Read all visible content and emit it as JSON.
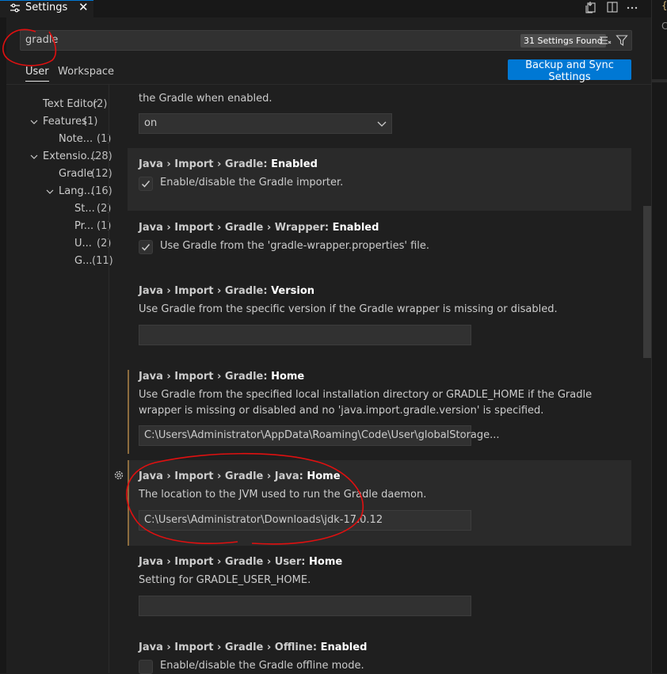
{
  "editor": {
    "tab_title": "Settings",
    "tab_close_glyph": "✕",
    "right_partial_brace": "{",
    "right_partial_letter": "C"
  },
  "search": {
    "value": "gradle",
    "results_badge": "31 Settings Found"
  },
  "scopes": {
    "user": "User",
    "workspace": "Workspace"
  },
  "sync_button": "Backup and Sync Settings",
  "toc": [
    {
      "label": "Text Editor",
      "count": "(2)"
    },
    {
      "label": "Features",
      "count": "(1)"
    },
    {
      "label": "Note...",
      "count": "(1)"
    },
    {
      "label": "Extensio...",
      "count": "(28)"
    },
    {
      "label": "Gradle",
      "count": "(12)"
    },
    {
      "label": "Lang...",
      "count": "(16)"
    },
    {
      "label": "St...",
      "count": "(2)"
    },
    {
      "label": "Pr...",
      "count": "(1)"
    },
    {
      "label": "U...",
      "count": "(2)"
    },
    {
      "label": "G...",
      "count": "(11)"
    }
  ],
  "settings": {
    "partial_top": {
      "desc_tail": "the Gradle when enabled.",
      "select_value": "on"
    },
    "gradle_enabled": {
      "category": "Java › Import › Gradle: ",
      "key": "Enabled",
      "checkbox_label": "Enable/disable the Gradle importer."
    },
    "wrapper_enabled": {
      "category": "Java › Import › Gradle › Wrapper: ",
      "key": "Enabled",
      "checkbox_label": "Use Gradle from the 'gradle-wrapper.properties' file."
    },
    "version": {
      "category": "Java › Import › Gradle: ",
      "key": "Version",
      "desc": "Use Gradle from the specific version if the Gradle wrapper is missing or disabled.",
      "value": ""
    },
    "home": {
      "category": "Java › Import › Gradle: ",
      "key": "Home",
      "desc": "Use Gradle from the specified local installation directory or GRADLE_HOME if the Gradle wrapper is missing or disabled and no 'java.import.gradle.version' is specified.",
      "value": "C:\\Users\\Administrator\\AppData\\Roaming\\Code\\User\\globalStorage..."
    },
    "java_home": {
      "category": "Java › Import › Gradle › Java: ",
      "key": "Home",
      "desc": "The location to the JVM used to run the Gradle daemon.",
      "value": "C:\\Users\\Administrator\\Downloads\\jdk-17.0.12"
    },
    "user_home": {
      "category": "Java › Import › Gradle › User: ",
      "key": "Home",
      "desc": "Setting for GRADLE_USER_HOME.",
      "value": ""
    },
    "offline": {
      "category": "Java › Import › Gradle › Offline: ",
      "key": "Enabled",
      "checkbox_label": "Enable/disable the Gradle offline mode."
    }
  },
  "colors": {
    "accent": "#0078d4",
    "background": "#1f1f1f",
    "annotation": "#e01010",
    "modified_bar": "#8c6c3e"
  }
}
